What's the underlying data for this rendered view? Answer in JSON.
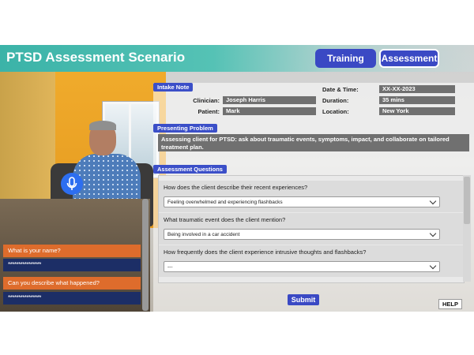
{
  "header": {
    "title": "PTSD Assessment Scenario",
    "nav": {
      "training": "Training",
      "assessment": "Assessment"
    }
  },
  "intake": {
    "section_label": "Intake Note",
    "clinician_label": "Clinician:",
    "clinician_value": "Joseph Harris",
    "patient_label": "Patient:",
    "patient_value": "Mark",
    "datetime_label": "Date & Time:",
    "datetime_value": "XX-XX-2023",
    "duration_label": "Duration:",
    "duration_value": "35 mins",
    "location_label": "Location:",
    "location_value": "New York"
  },
  "presenting": {
    "section_label": "Presenting Problem",
    "text": "Assessing client for PTSD: ask about traumatic events, symptoms, impact, and collaborate on tailored treatment plan."
  },
  "assessment": {
    "section_label": "Assessment Questions",
    "questions": [
      {
        "question": "How does the client describe their recent experiences?",
        "answer": "Feeling overwhelmed and experiencing flashbacks"
      },
      {
        "question": "What traumatic event does the client mention?",
        "answer": "Being involved in a car accident"
      },
      {
        "question": "How frequently does the client experience intrusive thoughts and flashbacks?",
        "answer": "---"
      }
    ],
    "submit_label": "Submit",
    "help_label": "HELP"
  },
  "chat": [
    {
      "prompt": "What is your name?",
      "answer": "****************"
    },
    {
      "prompt": "Can you describe what happened?",
      "answer": "****************"
    }
  ],
  "colors": {
    "accent": "#3a49c4",
    "header_teal": "#3bb3a8",
    "prompt_orange": "#de6c2c",
    "answer_navy": "#1c2e66"
  }
}
